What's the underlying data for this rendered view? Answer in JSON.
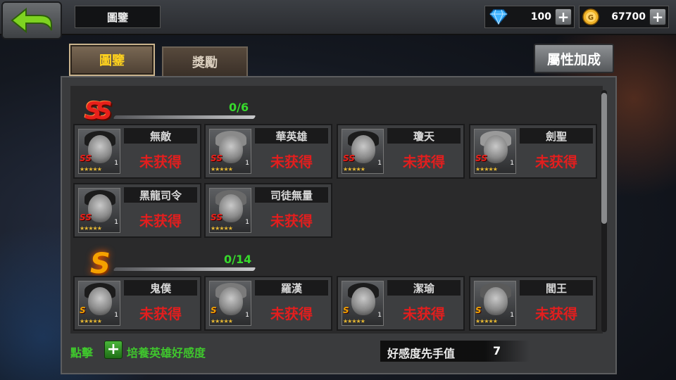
{
  "header": {
    "title": "圖鑒",
    "diamonds": "100",
    "gold": "67700"
  },
  "tabs": [
    {
      "label": "圖鑒",
      "active": true
    },
    {
      "label": "獎勵",
      "active": false
    }
  ],
  "attribute_bonus_label": "屬性加成",
  "sections": [
    {
      "rank": "SS",
      "count": "0/6",
      "heroes": [
        {
          "name": "無敵",
          "status": "未获得",
          "level": "1"
        },
        {
          "name": "華英雄",
          "status": "未获得",
          "level": "1"
        },
        {
          "name": "瓊天",
          "status": "未获得",
          "level": "1"
        },
        {
          "name": "劍聖",
          "status": "未获得",
          "level": "1"
        },
        {
          "name": "黑龍司令",
          "status": "未获得",
          "level": "1"
        },
        {
          "name": "司徒無量",
          "status": "未获得",
          "level": "1"
        }
      ]
    },
    {
      "rank": "S",
      "count": "0/14",
      "heroes": [
        {
          "name": "鬼僕",
          "status": "未获得",
          "level": "1"
        },
        {
          "name": "羅漢",
          "status": "未获得",
          "level": "1"
        },
        {
          "name": "潔瑜",
          "status": "未获得",
          "level": "1"
        },
        {
          "name": "閻王",
          "status": "未获得",
          "level": "1"
        }
      ]
    }
  ],
  "footer": {
    "tap_label": "點擊",
    "nurture_label": "培養英雄好感度",
    "favor_label": "好感度先手值",
    "favor_value": "7"
  },
  "colors": {
    "accent_gold": "#ffd21e",
    "not_owned_red": "#e21e1e",
    "count_green": "#37d92c"
  }
}
